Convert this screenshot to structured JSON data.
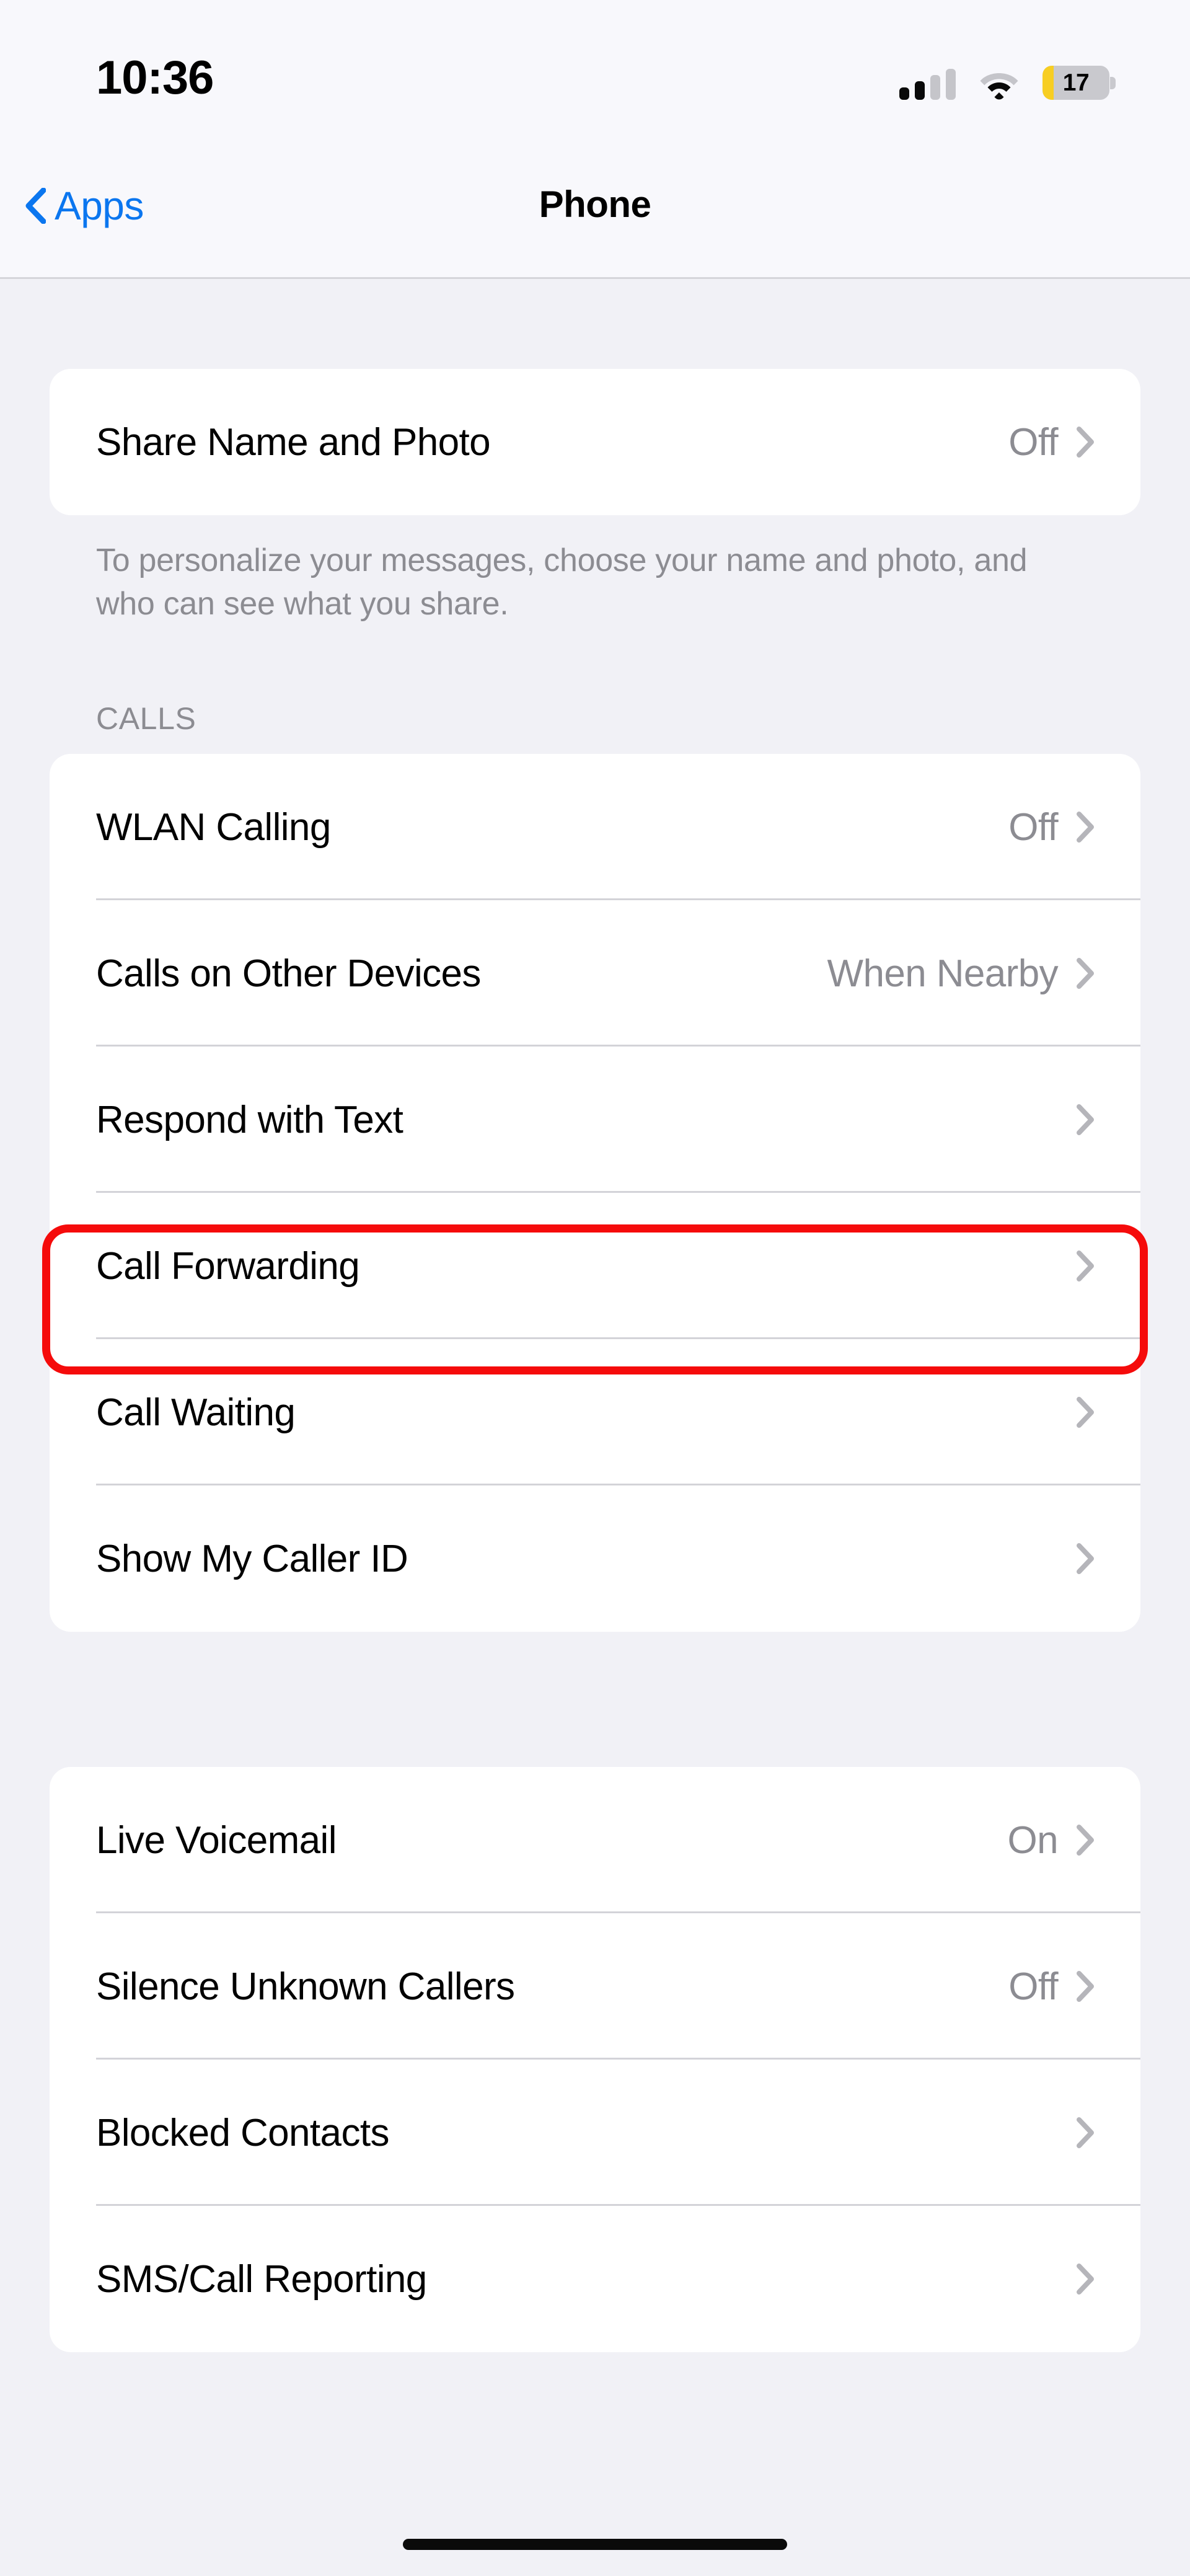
{
  "status_bar": {
    "time": "10:36",
    "cellular_icon": "cellular-signal-icon",
    "cellular_bars_filled": 2,
    "cellular_bars_total": 4,
    "wifi_icon": "wifi-icon",
    "battery_icon": "battery-icon",
    "battery_percent": "17",
    "battery_level": 17,
    "battery_color": "#F7CE22"
  },
  "nav": {
    "back_label": "Apps",
    "back_icon": "chevron-left-icon",
    "title": "Phone",
    "accent_color": "#0B76EF"
  },
  "groups": [
    {
      "id": "share-group",
      "header": "",
      "rows": [
        {
          "label": "Share Name and Photo",
          "value": "Off",
          "chevron": true
        }
      ],
      "footnote": "To personalize your messages, choose your name and photo, and who can see what you share."
    },
    {
      "id": "calls-group",
      "header": "CALLS",
      "rows": [
        {
          "label": "WLAN Calling",
          "value": "Off",
          "chevron": true
        },
        {
          "label": "Calls on Other Devices",
          "value": "When Nearby",
          "chevron": true
        },
        {
          "label": "Respond with Text",
          "value": "",
          "chevron": true
        },
        {
          "label": "Call Forwarding",
          "value": "",
          "chevron": true,
          "highlighted": true
        },
        {
          "label": "Call Waiting",
          "value": "",
          "chevron": true
        },
        {
          "label": "Show My Caller ID",
          "value": "",
          "chevron": true
        }
      ],
      "footnote": ""
    },
    {
      "id": "voicemail-group",
      "header": "",
      "rows": [
        {
          "label": "Live Voicemail",
          "value": "On",
          "chevron": true
        },
        {
          "label": "Silence Unknown Callers",
          "value": "Off",
          "chevron": true
        },
        {
          "label": "Blocked Contacts",
          "value": "",
          "chevron": true
        },
        {
          "label": "SMS/Call Reporting",
          "value": "",
          "chevron": true
        }
      ],
      "footnote": ""
    }
  ],
  "highlight": {
    "target_label": "Call Forwarding",
    "color": "#F50B0B"
  },
  "home_indicator": "home-indicator"
}
